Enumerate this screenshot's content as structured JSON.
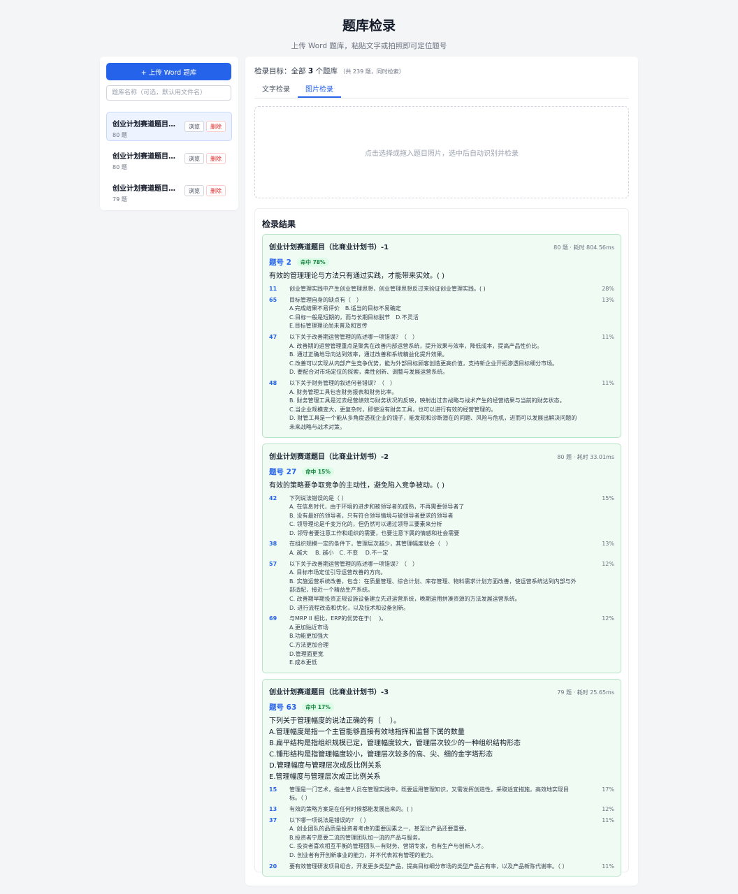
{
  "header": {
    "title": "题库检录",
    "subtitle": "上传 Word 题库，粘贴文字或拍照即可定位题号"
  },
  "sidebar": {
    "upload_label": "+ 上传 Word 题库",
    "name_placeholder": "题库名称（可选，默认用文件名）",
    "banks": [
      {
        "name": "创业计划赛道题目（比商业计划书）-1",
        "count": "80 题",
        "browse": "浏览",
        "delete": "删除"
      },
      {
        "name": "创业计划赛道题目（比商业计划书）-2",
        "count": "80 题",
        "browse": "浏览",
        "delete": "删除"
      },
      {
        "name": "创业计划赛道题目（比商业计划书）-3",
        "count": "79 题",
        "browse": "浏览",
        "delete": "删除"
      }
    ]
  },
  "main": {
    "target_prefix": "检录目标：全部",
    "target_count": "3",
    "target_suffix": "个题库",
    "target_note": "（共 239 题，同时检索）",
    "tabs": [
      {
        "label": "文字检录",
        "active": false
      },
      {
        "label": "图片检录",
        "active": true
      }
    ],
    "dropzone_text": "点击选择或拖入题目照片，选中后自动识别并检录",
    "results_title": "检录结果"
  },
  "results": [
    {
      "bank": "创业计划赛道题目（比商业计划书）-1",
      "meta": "80 题 · 耗时 804.56ms",
      "qno": "题号 2",
      "badge": "命中 78%",
      "question": [
        "有效的管理理论与方法只有通过实践，才能带来实效。( )"
      ],
      "candidates": [
        {
          "no": "11",
          "pct": "28%",
          "lines": [
            "创业管理实践中产生创业管理思想，创业管理思想反过来验证创业管理实践。( )"
          ]
        },
        {
          "no": "65",
          "pct": "13%",
          "lines": [
            "目标管理自身的缺点有（　）",
            "A.完成结果不易评价　B.适当的目标不易确定",
            "C.目标一般是短期的，而与长期目标脱节　D.不灵活",
            "E.目标管理理论尚未普及和宣传"
          ]
        },
        {
          "no": "47",
          "pct": "11%",
          "lines": [
            "以下关于改善期运营管理的陈述哪一项错误？（　）",
            "A. 改善期的运营管理重点是聚焦在改善内部运营系统，提升效果与效率，降低成本，提高产品性价比。",
            "B. 通过正确地导向达到效率，通过改善和系统精益化提升效果。",
            "C.改善可以实现从内部产生竞争优势，能为外部目标顾客创造更高价值，支持新企业开拓渗透目标细分市场。",
            "D. 要配合对市场定位的探索，柔性创新、调整与发展运营系统。"
          ]
        },
        {
          "no": "48",
          "pct": "11%",
          "lines": [
            "以下关于财务管理的叙述何者错误？（　）",
            "A. 财务管理工具包含财务报表和财务比率。",
            "B. 财务管理工具是过去经营绩效与财务状况的反映，映射出过去战略与战术产生的经营结果与当前的财务状态。",
            "C.当企业规模变大，更复杂时，即使没有财务工具，也可以进行有效的经营管理的。",
            "D. 财管工具是一个能从多角度透视企业的镜子，能发现和诊断潜在的问题、风险与危机，进而可以发展出解决问题的",
            "未来战略与战术对策。"
          ]
        }
      ]
    },
    {
      "bank": "创业计划赛道题目（比商业计划书）-2",
      "meta": "80 题 · 耗时 33.01ms",
      "qno": "题号 27",
      "badge": "命中 15%",
      "question": [
        "有效的策略要争取竞争的主动性，避免陷入竞争被动。( )"
      ],
      "candidates": [
        {
          "no": "42",
          "pct": "15%",
          "lines": [
            "下列说法错误的是（ ）",
            "A. 在信息时代，由于环境的进步和被领导者的成熟，不再需要领导者了",
            "B. 没有最好的领导者，只有符合领导情境与被领导者要求的领导者",
            "C. 领导理论是千变万化的，但仍然可以通过领导三要素来分析",
            "D. 领导者要注意工作和组织的需要，也要注意下属的情感和社会需要"
          ]
        },
        {
          "no": "38",
          "pct": "13%",
          "lines": [
            "在组织规模一定的条件下，管理层次越少，其管理幅度就会（　）",
            "A. 越大　 B. 越小　C. 不变　 D.不一定"
          ]
        },
        {
          "no": "57",
          "pct": "12%",
          "lines": [
            "以下关于改善期运营管理的陈述哪一项错误？（　）",
            "A. 目标市场定位引导运营改善的方向。",
            "B. 实施运营系统改善，包含：在质量管理、综合计划、库存管理、物料需求计划方面改善，使运营系统达到内部与外",
            "部适配，接近一个精益生产系统。",
            "C. 改善期早期投资正规设施设备建立先进运营系统，晚期运用拼凑资源的方法发展运营系统。",
            "D. 进行流程改造和优化，以及技术和设备创新。"
          ]
        },
        {
          "no": "69",
          "pct": "12%",
          "lines": [
            "与MRP II 相比，ERP的优势在于(　 )。",
            "A.更加贴近市场",
            "B.功能更加强大",
            "C.方法更加合理",
            "D.管理面更宽",
            "E.成本更低"
          ]
        }
      ]
    },
    {
      "bank": "创业计划赛道题目（比商业计划书）-3",
      "meta": "79 题 · 耗时 25.65ms",
      "qno": "题号 63",
      "badge": "命中 17%",
      "question": [
        "下列关于管理幅度的说法正确的有（　 ）。",
        "A.管理幅度是指一个主管能够直接有效地指挥和监督下属的数量",
        "B.扁平结构是指组织规模已定，管理幅度较大，管理层次较少的一种组织结构形态",
        "C.锤形结构是指管理幅度较小，管理层次较多的高、尖、细的金字塔形态",
        "D.管理幅度与管理层次成反比例关系",
        "E.管理幅度与管理层次成正比例关系"
      ],
      "candidates": [
        {
          "no": "15",
          "pct": "17%",
          "lines": [
            "管理是一门艺术，指主管人员在管理实践中，既要运用管理知识，又需发挥创造性，采取适宜措施，高效地实现目",
            "标。（ ）"
          ]
        },
        {
          "no": "13",
          "pct": "12%",
          "lines": [
            "有效的策略方案是在任何时候都能发展出来的。( )"
          ]
        },
        {
          "no": "37",
          "pct": "11%",
          "lines": [
            "以下哪一项说法是错误的？（ ）",
            "A. 创业团队的品质是投资者考虑的重要因素之一，甚至比产品还要重要。",
            "B.投资者宁愿要二流的管理团队加一流的产品与服务。",
            "C. 投资者喜欢相互平衡的管理团队—有财务、营销专家，也有生产与创新人才。",
            "D. 创业者有开创新事业的能力，并不代表就有管理的能力。"
          ]
        },
        {
          "no": "20",
          "pct": "11%",
          "lines": [
            "要有效管理研发项目组合，开发更多类型产品，提高目标细分市场的类型产品占有率，以及产品新陈代谢率。（ ）"
          ]
        }
      ]
    }
  ]
}
